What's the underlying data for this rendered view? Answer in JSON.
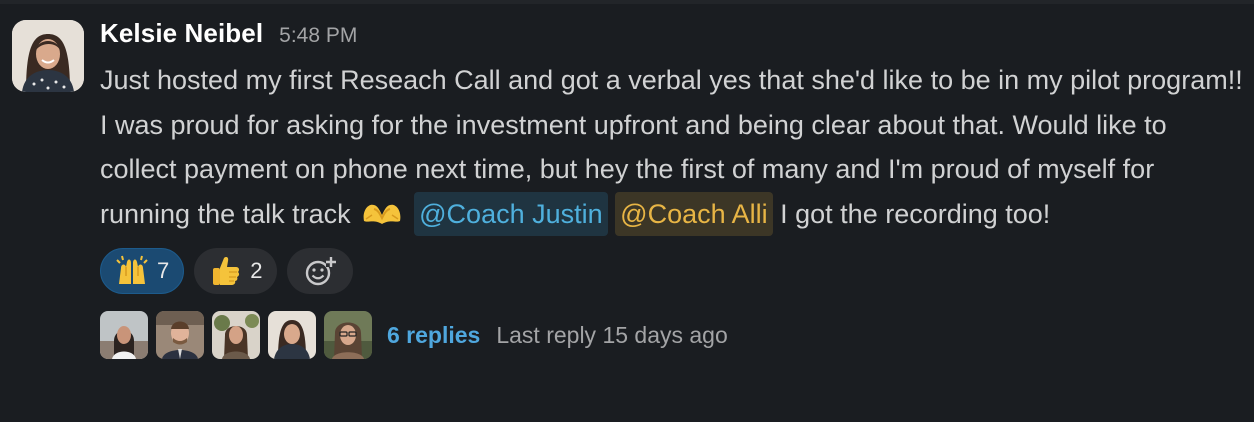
{
  "message": {
    "author": "Kelsie Neibel",
    "time": "5:48 PM",
    "text_1": "Just hosted my first Reseach Call and got a verbal yes that she'd like to be in my pilot program!!  I was proud for asking for the investment upfront and being clear about that. Would like to collect payment on phone next time, but hey the first of many and I'm proud of myself for running the talk track ",
    "emoji": "heart-hands-emoji",
    "mentions": [
      "@Coach Justin",
      "@Coach Alli"
    ],
    "text_2": " I got the recording too!"
  },
  "reactions": [
    {
      "emoji": "raising-hands-emoji",
      "count": "7",
      "selected": true
    },
    {
      "emoji": "thumbs-up-emoji",
      "count": "2",
      "selected": false
    }
  ],
  "add_reaction_icon": "add-reaction-icon",
  "thread": {
    "replies": "6 replies",
    "last_reply": "Last reply 15 days ago",
    "participant_count": 5
  },
  "colors": {
    "background": "#1a1d21",
    "mention_blue": "#4fb0dd",
    "mention_yellow": "#e8b545",
    "link": "#4fa7de",
    "selected_reaction": "#1b4a72"
  }
}
